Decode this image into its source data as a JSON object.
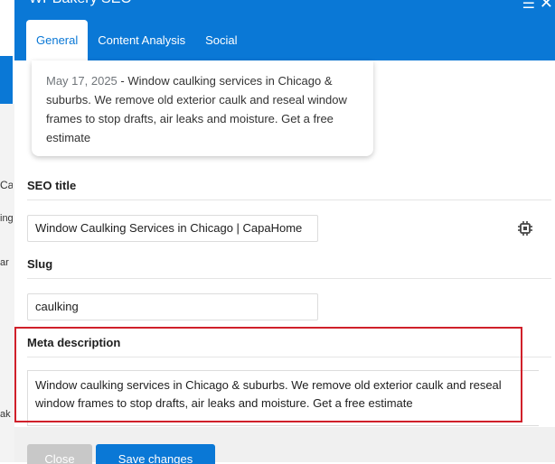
{
  "background_page": {
    "fragments": [
      "Ca",
      "ing le",
      "ar",
      "ak"
    ]
  },
  "modal": {
    "title": "WPBakery SEO",
    "tabs": [
      {
        "label": "General",
        "active": true
      },
      {
        "label": "Content Analysis",
        "active": false
      },
      {
        "label": "Social",
        "active": false
      }
    ],
    "preview": {
      "date": "May 17, 2025",
      "separator": " - ",
      "snippet": "Window caulking services in Chicago & suburbs. We remove old exterior caulk and reseal window frames to stop drafts, air leaks and moisture. Get a free estimate"
    },
    "seo_title": {
      "label": "SEO title",
      "value": "Window Caulking Services in Chicago | CapaHome"
    },
    "slug": {
      "label": "Slug",
      "value": "caulking"
    },
    "meta_description": {
      "label": "Meta description",
      "value": "Window caulking services in Chicago & suburbs. We remove old exterior caulk and reseal window frames to stop drafts, air leaks and moisture. Get a free estimate"
    },
    "footer": {
      "close_label": "Close",
      "save_label": "Save changes"
    }
  },
  "colors": {
    "header_blue": "#0a78d6",
    "highlight_red": "#d0202a"
  }
}
